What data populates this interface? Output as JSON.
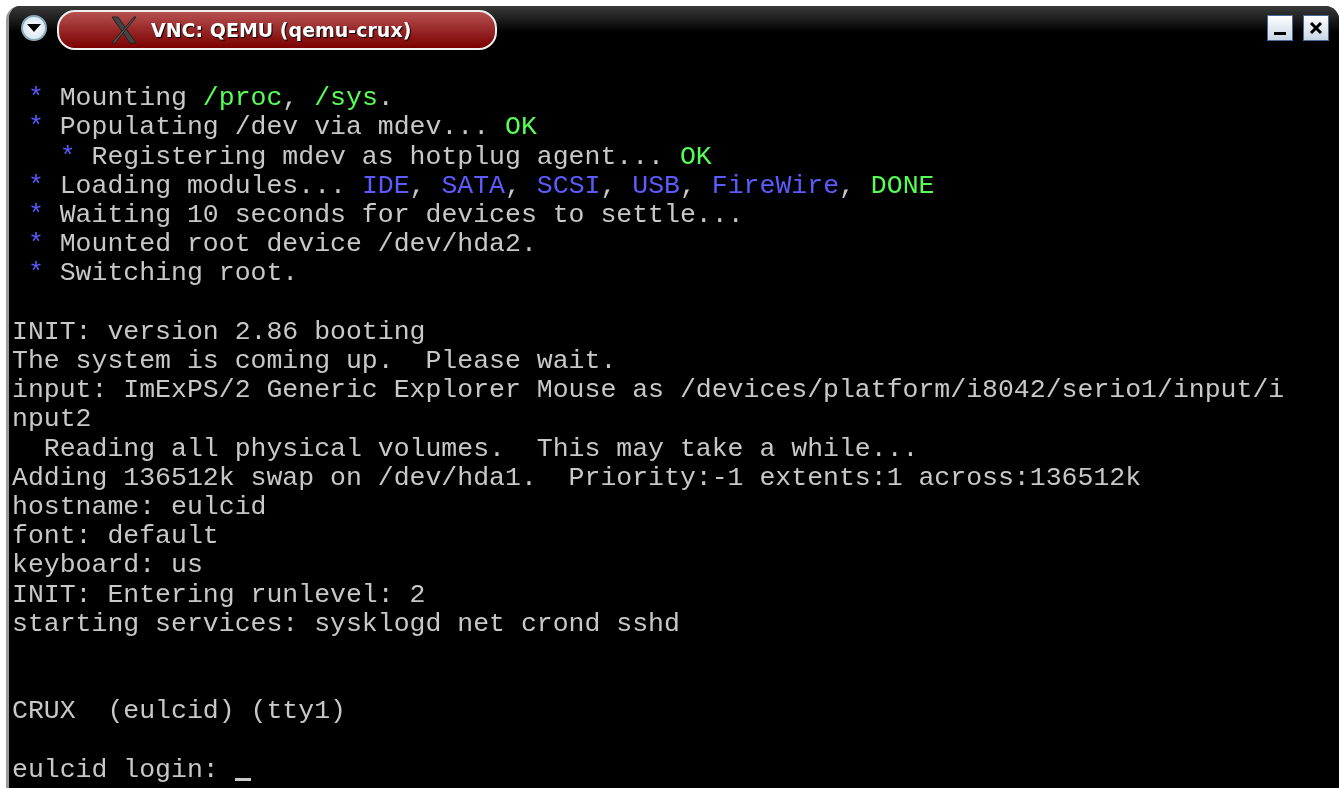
{
  "window": {
    "title": "VNC: QEMU (qemu-crux)"
  },
  "console": {
    "blocks": [
      {
        "wide_gap": false,
        "lines": [
          {
            "segments": [
              {
                "text": " * ",
                "kind": "bullet"
              },
              {
                "text": "Mounting ",
                "kind": "plain"
              },
              {
                "text": "/proc",
                "kind": "green"
              },
              {
                "text": ", ",
                "kind": "plain"
              },
              {
                "text": "/sys",
                "kind": "green"
              },
              {
                "text": ".",
                "kind": "plain"
              }
            ]
          },
          {
            "segments": [
              {
                "text": " * ",
                "kind": "bullet"
              },
              {
                "text": "Populating /dev via mdev... ",
                "kind": "plain"
              },
              {
                "text": "OK",
                "kind": "green"
              }
            ]
          },
          {
            "segments": [
              {
                "text": "   * ",
                "kind": "bullet"
              },
              {
                "text": "Registering mdev as hotplug agent... ",
                "kind": "plain"
              },
              {
                "text": "OK",
                "kind": "green"
              }
            ]
          },
          {
            "segments": [
              {
                "text": " * ",
                "kind": "bullet"
              },
              {
                "text": "Loading modules... ",
                "kind": "plain"
              },
              {
                "text": "IDE",
                "kind": "blue"
              },
              {
                "text": ", ",
                "kind": "plain"
              },
              {
                "text": "SATA",
                "kind": "blue"
              },
              {
                "text": ", ",
                "kind": "plain"
              },
              {
                "text": "SCSI",
                "kind": "blue"
              },
              {
                "text": ", ",
                "kind": "plain"
              },
              {
                "text": "USB",
                "kind": "blue"
              },
              {
                "text": ", ",
                "kind": "plain"
              },
              {
                "text": "FireWire",
                "kind": "blue"
              },
              {
                "text": ", ",
                "kind": "plain"
              },
              {
                "text": "DONE",
                "kind": "green"
              }
            ]
          },
          {
            "segments": [
              {
                "text": " * ",
                "kind": "bullet"
              },
              {
                "text": "Waiting 10 seconds for devices to settle...",
                "kind": "plain"
              }
            ]
          },
          {
            "segments": [
              {
                "text": " * ",
                "kind": "bullet"
              },
              {
                "text": "Mounted root device /dev/hda2.",
                "kind": "plain"
              }
            ]
          },
          {
            "segments": [
              {
                "text": " * ",
                "kind": "bullet"
              },
              {
                "text": "Switching root.",
                "kind": "plain"
              }
            ]
          }
        ]
      },
      {
        "wide_gap": false,
        "lines": [
          {
            "segments": [
              {
                "text": "INIT: version 2.86 booting",
                "kind": "plain"
              }
            ]
          },
          {
            "segments": [
              {
                "text": "The system is coming up.  Please wait.",
                "kind": "plain"
              }
            ]
          },
          {
            "segments": [
              {
                "text": "input: ImExPS/2 Generic Explorer Mouse as /devices/platform/i8042/serio1/input/i",
                "kind": "plain"
              }
            ]
          },
          {
            "segments": [
              {
                "text": "nput2",
                "kind": "plain"
              }
            ]
          },
          {
            "segments": [
              {
                "text": "  Reading all physical volumes.  This may take a while...",
                "kind": "plain"
              }
            ]
          },
          {
            "segments": [
              {
                "text": "Adding 136512k swap on /dev/hda1.  Priority:-1 extents:1 across:136512k",
                "kind": "plain"
              }
            ]
          },
          {
            "segments": [
              {
                "text": "hostname: eulcid",
                "kind": "plain"
              }
            ]
          },
          {
            "segments": [
              {
                "text": "font: default",
                "kind": "plain"
              }
            ]
          },
          {
            "segments": [
              {
                "text": "keyboard: us",
                "kind": "plain"
              }
            ]
          },
          {
            "segments": [
              {
                "text": "INIT: Entering runlevel: 2",
                "kind": "plain"
              }
            ]
          },
          {
            "segments": [
              {
                "text": "starting services: sysklogd net crond sshd",
                "kind": "plain"
              }
            ]
          }
        ]
      },
      {
        "wide_gap": true,
        "lines": [
          {
            "segments": [
              {
                "text": "CRUX  (eulcid) (tty1)",
                "kind": "plain"
              }
            ]
          }
        ]
      },
      {
        "wide_gap": false,
        "lines": [
          {
            "segments": [
              {
                "text": "eulcid login: ",
                "kind": "plain"
              }
            ],
            "cursor": true
          }
        ]
      }
    ]
  }
}
